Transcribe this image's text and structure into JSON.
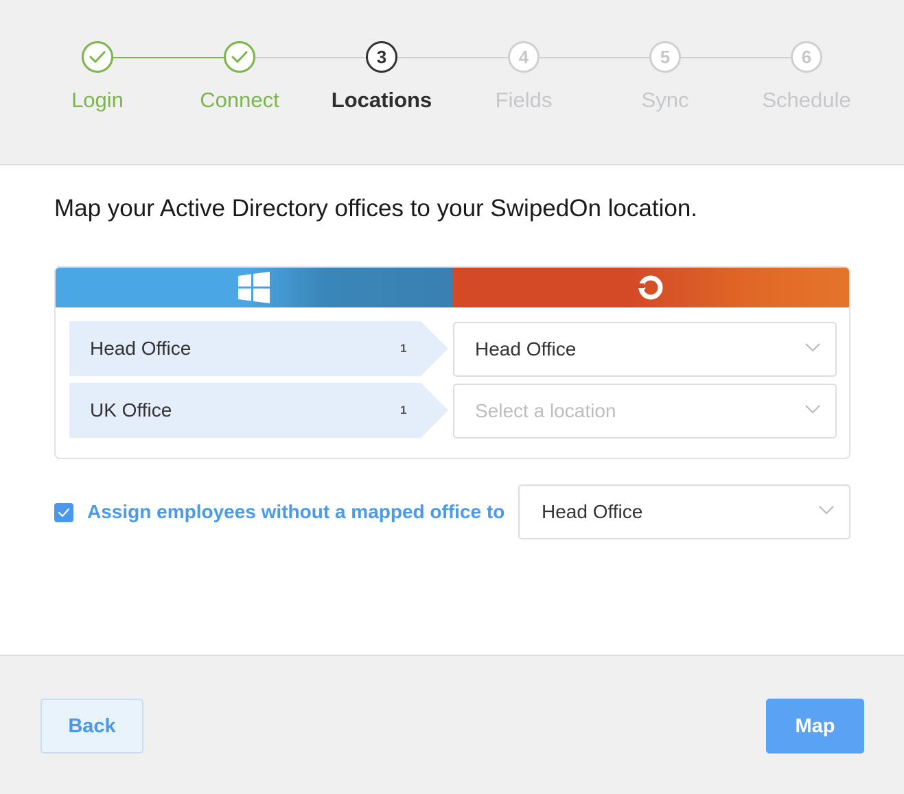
{
  "stepper": {
    "steps": [
      {
        "label": "Login",
        "number": "1",
        "state": "done"
      },
      {
        "label": "Connect",
        "number": "2",
        "state": "done"
      },
      {
        "label": "Locations",
        "number": "3",
        "state": "active"
      },
      {
        "label": "Fields",
        "number": "4",
        "state": "pending"
      },
      {
        "label": "Sync",
        "number": "5",
        "state": "pending"
      },
      {
        "label": "Schedule",
        "number": "6",
        "state": "pending"
      }
    ]
  },
  "main": {
    "instruction": "Map your Active Directory offices to your SwipedOn location.",
    "panel": {
      "left_icon": "windows-logo-icon",
      "right_icon": "swipedon-logo-icon",
      "rows": [
        {
          "ad_office": "Head Office",
          "count": "1",
          "selected": "Head Office",
          "placeholder": ""
        },
        {
          "ad_office": "UK Office",
          "count": "1",
          "selected": "",
          "placeholder": "Select a location"
        }
      ]
    },
    "assign": {
      "checked": true,
      "label": "Assign employees without a mapped office to",
      "selected": "Head Office"
    }
  },
  "footer": {
    "back_label": "Back",
    "map_label": "Map"
  },
  "colors": {
    "success": "#7ab648",
    "active": "#333333",
    "pending": "#c6c7ca",
    "primary": "#5aa2f3",
    "windows_blue": "#4aa6e4",
    "swipedon_orange": "#d44a26"
  }
}
